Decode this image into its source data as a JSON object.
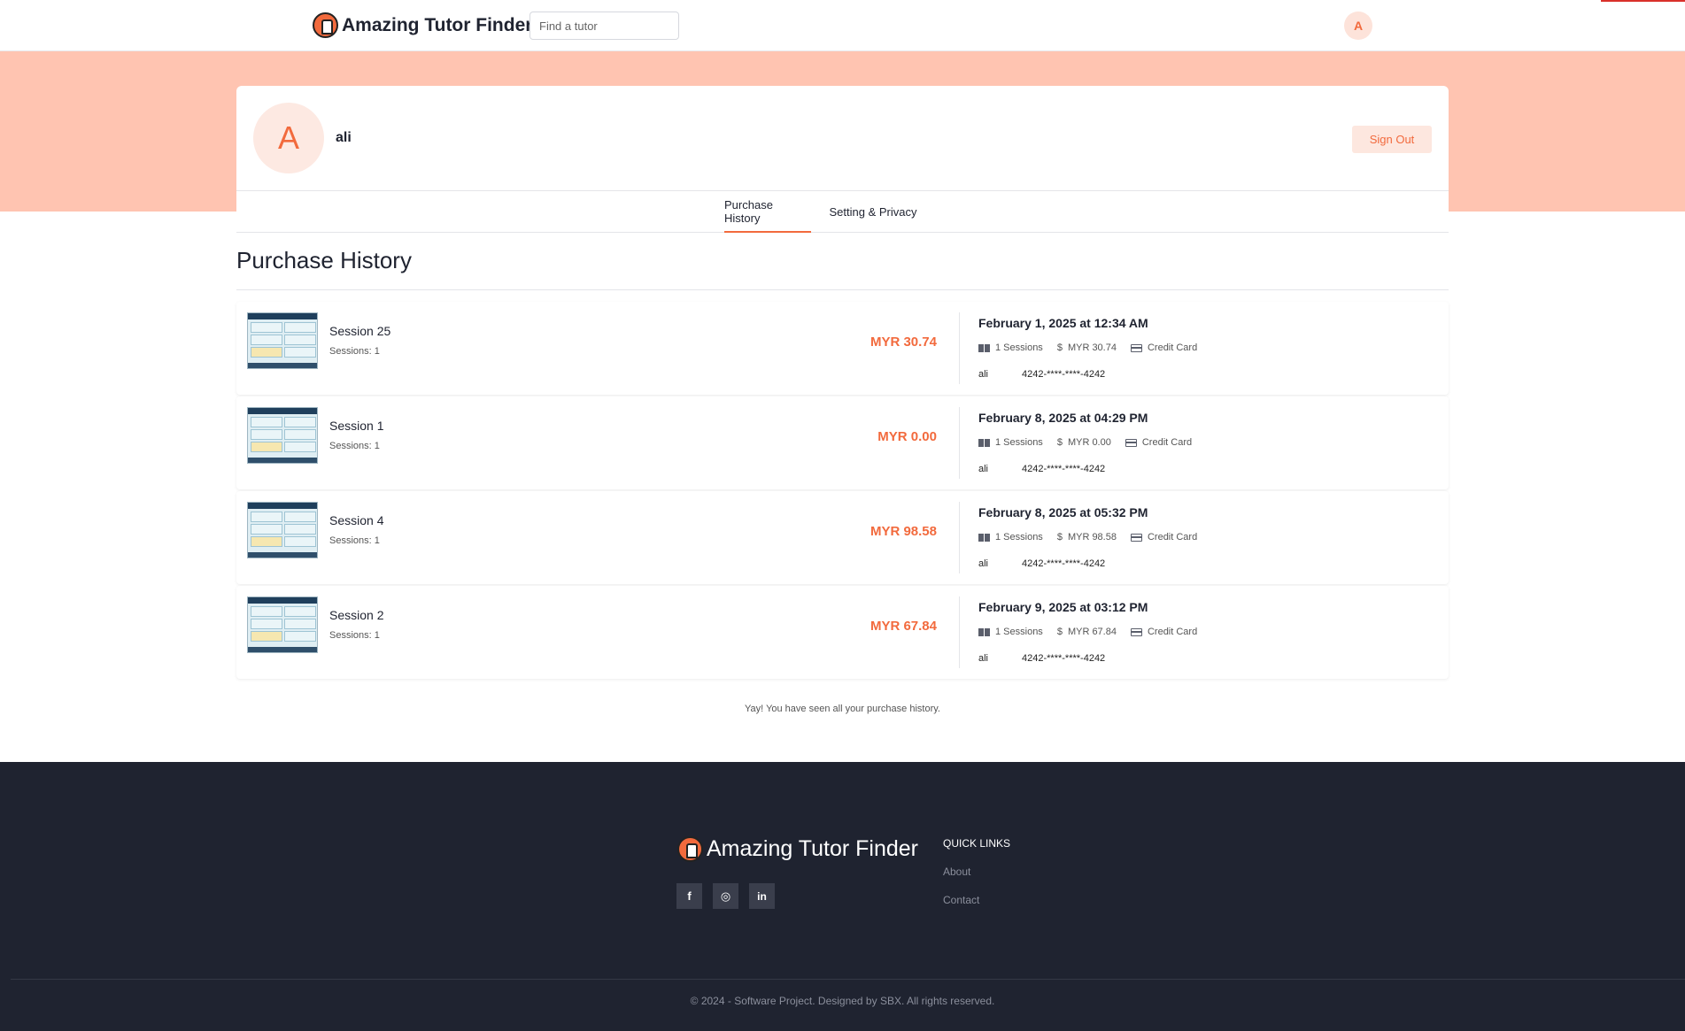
{
  "header": {
    "brand_name": "Amazing Tutor Finder",
    "search_placeholder": "Find a tutor",
    "avatar_initial": "A"
  },
  "profile": {
    "avatar_initial": "A",
    "username": "ali",
    "sign_out_label": "Sign Out"
  },
  "tabs": [
    {
      "label": "Purchase History",
      "active": true
    },
    {
      "label": "Setting & Privacy",
      "active": false
    }
  ],
  "section_title": "Purchase History",
  "purchases": [
    {
      "title": "Session 25",
      "sessions_label": "Sessions: 1",
      "price": "MYR 30.74",
      "date": "February 1, 2025 at 12:34 AM",
      "sessions_meta": "1 Sessions",
      "amount_meta": "MYR 30.74",
      "method": "Credit Card",
      "holder": "ali",
      "card_number": "4242-****-****-4242"
    },
    {
      "title": "Session 1",
      "sessions_label": "Sessions: 1",
      "price": "MYR 0.00",
      "date": "February 8, 2025 at 04:29 PM",
      "sessions_meta": "1 Sessions",
      "amount_meta": "MYR 0.00",
      "method": "Credit Card",
      "holder": "ali",
      "card_number": "4242-****-****-4242"
    },
    {
      "title": "Session 4",
      "sessions_label": "Sessions: 1",
      "price": "MYR 98.58",
      "date": "February 8, 2025 at 05:32 PM",
      "sessions_meta": "1 Sessions",
      "amount_meta": "MYR 98.58",
      "method": "Credit Card",
      "holder": "ali",
      "card_number": "4242-****-****-4242"
    },
    {
      "title": "Session 2",
      "sessions_label": "Sessions: 1",
      "price": "MYR 67.84",
      "date": "February 9, 2025 at 03:12 PM",
      "sessions_meta": "1 Sessions",
      "amount_meta": "MYR 67.84",
      "method": "Credit Card",
      "holder": "ali",
      "card_number": "4242-****-****-4242"
    }
  ],
  "end_note": "Yay! You have seen all your purchase history.",
  "footer": {
    "brand_name": "Amazing Tutor Finder",
    "socials": [
      {
        "icon": "facebook-icon",
        "glyph": "f"
      },
      {
        "icon": "instagram-icon",
        "glyph": "◎"
      },
      {
        "icon": "linkedin-icon",
        "glyph": "in"
      }
    ],
    "quick_links_title": "QUICK LINKS",
    "quick_links": [
      "About",
      "Contact"
    ],
    "copyright": "© 2024 - Software Project. Designed by SBX. All rights reserved."
  },
  "colors": {
    "accent": "#f26a3d",
    "hero_band": "#ffc4b1",
    "footer_bg": "#1f2330"
  }
}
